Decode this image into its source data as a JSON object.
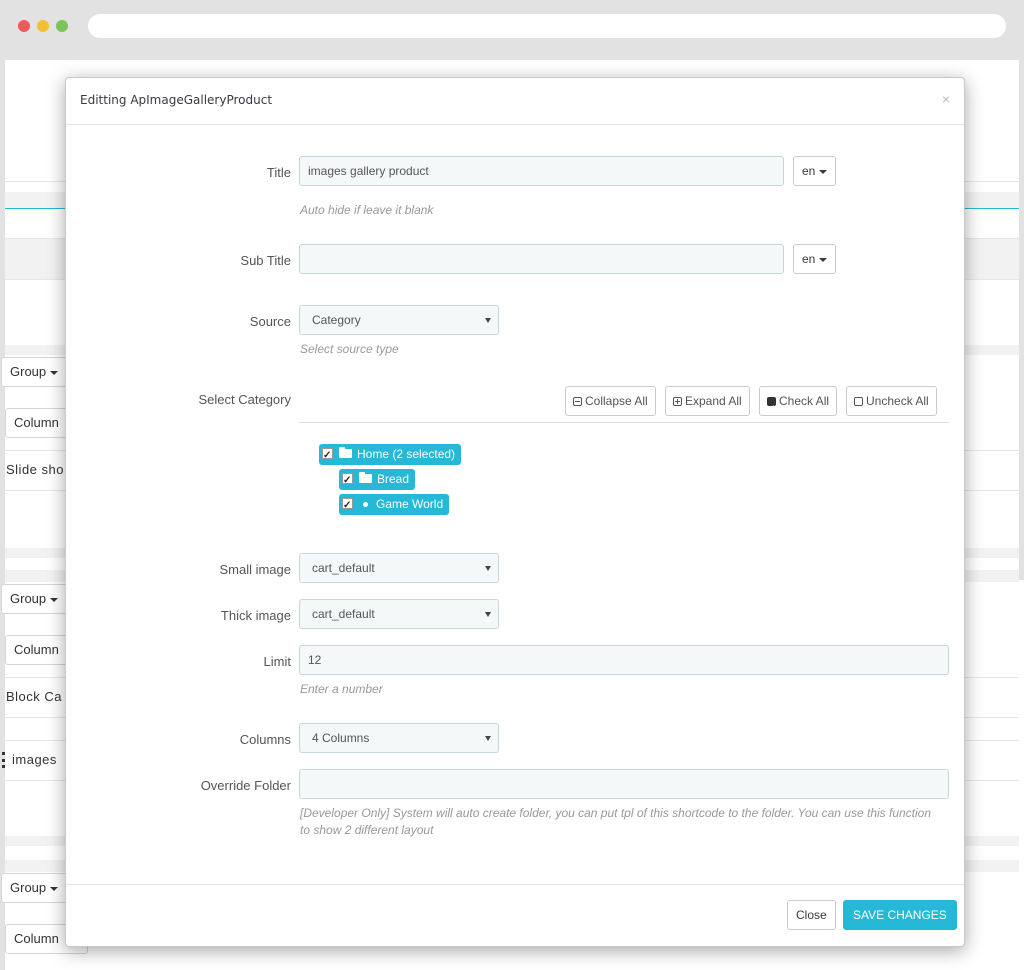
{
  "background": {
    "group_label": "Group",
    "column_label": "Column",
    "row_text_1": "Slide sho",
    "row_text_2": "Block Ca",
    "row_text_3": "images"
  },
  "modal": {
    "title": "Editting ApImageGalleryProduct",
    "close_glyph": "×",
    "fields": {
      "title": {
        "label": "Title",
        "value": "images gallery product",
        "lang": "en",
        "help": "Auto hide if leave it blank"
      },
      "subtitle": {
        "label": "Sub Title",
        "value": "",
        "lang": "en"
      },
      "source": {
        "label": "Source",
        "value": "Category",
        "help": "Select source type"
      },
      "select_category": {
        "label": "Select Category"
      },
      "small_image": {
        "label": "Small image",
        "value": "cart_default"
      },
      "thick_image": {
        "label": "Thick image",
        "value": "cart_default"
      },
      "limit": {
        "label": "Limit",
        "value": "12",
        "help": "Enter a number"
      },
      "columns": {
        "label": "Columns",
        "value": "4 Columns"
      },
      "override_folder": {
        "label": "Override Folder",
        "value": "",
        "help": "[Developer Only] System will auto create folder, you can put tpl of this shortcode to the folder. You can use this function to show 2 different layout"
      }
    },
    "tree_toolbar": {
      "collapse_all": "Collapse All",
      "expand_all": "Expand All",
      "check_all": "Check All",
      "uncheck_all": "Uncheck All"
    },
    "tree": {
      "root": "Home (2 selected)",
      "child_1": "Bread",
      "child_2": "Game World"
    },
    "footer": {
      "close_label": "Close",
      "save_label": "SAVE CHANGES"
    }
  },
  "colors": {
    "accent": "#25b9d7",
    "input_bg": "#f5f8f9",
    "input_border": "#c7d6db"
  }
}
